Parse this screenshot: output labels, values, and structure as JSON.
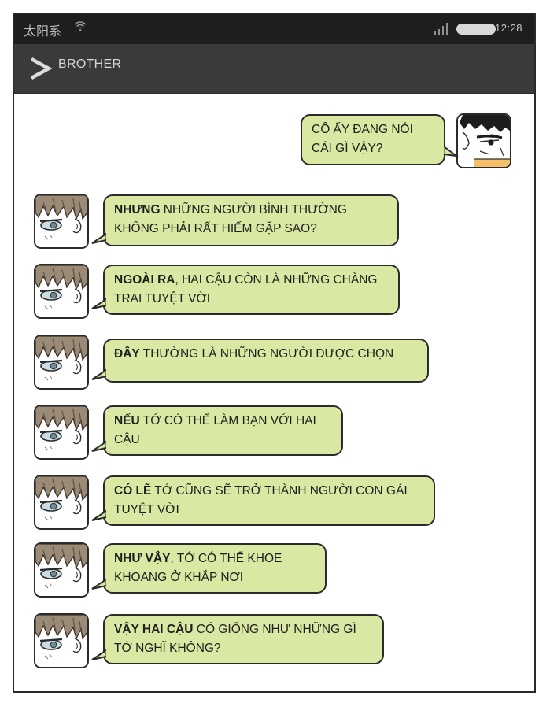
{
  "status_bar": {
    "carrier": "太阳系",
    "wifi_icon": "wifi-icon",
    "time": "12:28"
  },
  "header": {
    "back_icon": "chevron-right-icon",
    "title": "BROTHER"
  },
  "colors": {
    "bubble": "#d9e8a2",
    "header_bg": "#3a3a3a",
    "status_bg": "#1e1e1e"
  },
  "messages": [
    {
      "side": "right",
      "text": "CÔ ẤY ĐANG NÓI CÁI GÌ VẬY?"
    },
    {
      "side": "left",
      "bold": "NHƯNG",
      "text": " NHỮNG NGƯỜI BÌNH THƯỜNG KHÔNG PHẢI RẤT HIẾM GẶP SAO?"
    },
    {
      "side": "left",
      "bold": "NGOÀI RA",
      "text": ", HAI CẬU CÒN LÀ NHỮNG CHÀNG TRAI TUYỆT VỜI"
    },
    {
      "side": "left",
      "bold": "ĐÂY",
      "text": " THƯỜNG LÀ NHỮNG NGƯỜI ĐƯỢC CHỌN"
    },
    {
      "side": "left",
      "bold": "NẾU",
      "text": " TỚ CÓ THỂ LÀM BẠN VỚI HAI CẬU"
    },
    {
      "side": "left",
      "bold": "CÓ LẼ",
      "text": " TỚ CŨNG SẼ TRỞ THÀNH NGƯỜI CON GÁI TUYỆT VỜI"
    },
    {
      "side": "left",
      "bold": "NHƯ VẬY",
      "text": ", TỚ CÓ THỂ KHOE KHOANG Ở KHẮP NƠI"
    },
    {
      "side": "left",
      "bold": "VẬY HAI CẬU",
      "text": " CÓ GIỐNG NHƯ NHỮNG GÌ TỚ NGHĨ KHÔNG?"
    }
  ]
}
